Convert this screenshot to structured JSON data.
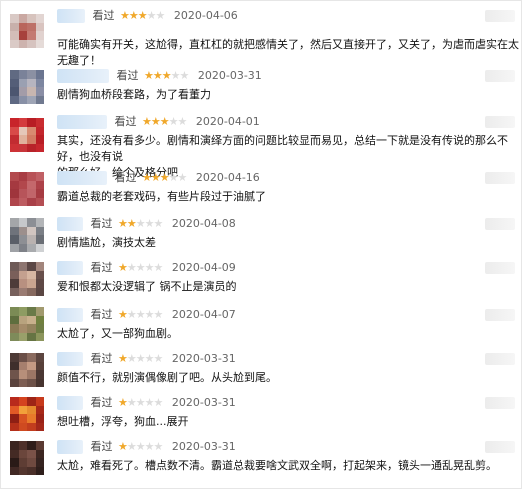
{
  "comments": [
    {
      "status": "看过",
      "rating": 3,
      "date": "2020-04-06",
      "text_lines": [
        "可能确实有开关，这尬得，直杠杠的就把感情关了，然后又直接开了，又关了，为虐而虐实在太无趣了！"
      ],
      "avatar_colors": [
        "#d9c9c5",
        "#caa8a2",
        "#d7c3bd",
        "#e2d5d2",
        "#c8b0ab",
        "#b9665c",
        "#bd7168",
        "#d9c4c0",
        "#d3bdb8",
        "#a7413c",
        "#c47a72",
        "#e1d2cf",
        "#dacac6",
        "#cdb3ae",
        "#d6c3bf",
        "#e5dbd8"
      ]
    },
    {
      "status": "看过",
      "rating": 3,
      "date": "2020-03-31",
      "text_lines": [
        "剧情狗血桥段套路，为了看董力"
      ],
      "avatar_colors": [
        "#606a82",
        "#7a8299",
        "#8b90a3",
        "#6b7590",
        "#545e78",
        "#9aa0b2",
        "#b7b5c0",
        "#7d86a0",
        "#4c5670",
        "#a39ca8",
        "#c8b6b0",
        "#8a8ea5",
        "#5f6983",
        "#8890a6",
        "#9ea4b5",
        "#70798f"
      ]
    },
    {
      "status": "看过",
      "rating": 3,
      "date": "2020-04-01",
      "text_lines": [
        "其实，还没有看多少。剧情和演绎方面的问题比较显而易见，总结一下就是没有传说的那么不好，也没有说",
        "的那么好，给个及格分吧"
      ],
      "avatar_colors": [
        "#c8242a",
        "#d43a3d",
        "#b81d24",
        "#c92c30",
        "#d84a48",
        "#e5c7b9",
        "#d88a70",
        "#c3262c",
        "#c22c31",
        "#e0b19c",
        "#d27b63",
        "#b91e25",
        "#cd3236",
        "#c8353a",
        "#b82229",
        "#c6262d"
      ]
    },
    {
      "status": "看过",
      "rating": 3,
      "date": "2020-04-16",
      "text_lines": [
        "霸道总裁的老套戏码，有些片段过于油腻了"
      ],
      "avatar_colors": [
        "#b34a4e",
        "#a83c43",
        "#b85257",
        "#c06065",
        "#a53940",
        "#b2474c",
        "#c4686c",
        "#ad4249",
        "#9f353c",
        "#b7545a",
        "#c1656a",
        "#a63b42",
        "#b0464c",
        "#bd5c61",
        "#a94048",
        "#b44e53"
      ]
    },
    {
      "status": "看过",
      "rating": 2,
      "date": "2020-04-08",
      "text_lines": [
        "剧情尴尬，演技太差"
      ],
      "avatar_colors": [
        "#a4a6a9",
        "#c6c8cb",
        "#8c8f95",
        "#b3b5b8",
        "#6f737b",
        "#9c8f8c",
        "#d1c5c0",
        "#7b7f86",
        "#5a5f68",
        "#8d8f94",
        "#b9b2b0",
        "#6a6e75",
        "#9fa2a6",
        "#7e8188",
        "#a9abae",
        "#cfd1d3"
      ]
    },
    {
      "status": "看过",
      "rating": 1,
      "date": "2020-04-09",
      "text_lines": [
        "爱和恨都太没逻辑了 锅不止是演员的"
      ],
      "avatar_colors": [
        "#6e5a57",
        "#8d7570",
        "#5b4745",
        "#a2857c",
        "#7a5f5a",
        "#c4a08f",
        "#d7b6a2",
        "#684f4b",
        "#4e3c3a",
        "#b89080",
        "#caa590",
        "#5e4845",
        "#77605c",
        "#9a7b72",
        "#86695f",
        "#5a4643"
      ]
    },
    {
      "status": "看过",
      "rating": 1,
      "date": "2020-04-07",
      "text_lines": [
        "太尬了，又一部狗血剧。"
      ],
      "avatar_colors": [
        "#7b8b55",
        "#8e9c62",
        "#6a7a48",
        "#a19a6e",
        "#5e6e3e",
        "#b8a37e",
        "#c8b08c",
        "#70803f",
        "#8a7a55",
        "#a58c6a",
        "#94835e",
        "#6f7d45",
        "#7e8b5a",
        "#99a06a",
        "#667443",
        "#8c955c"
      ]
    },
    {
      "status": "看过",
      "rating": 1,
      "date": "2020-03-31",
      "text_lines": [
        "颜值不行，就别演偶像剧了吧。从头尬到尾。"
      ],
      "avatar_colors": [
        "#4d3a36",
        "#6b4f48",
        "#8a6a5e",
        "#5c453f",
        "#3f2f2c",
        "#a67f6e",
        "#c49a84",
        "#574039",
        "#6f544b",
        "#b78f7a",
        "#9b7665",
        "#4a3733",
        "#5a433d",
        "#7d5e53",
        "#6c5148",
        "#46342f"
      ]
    },
    {
      "status": "看过",
      "rating": 1,
      "date": "2020-03-31",
      "text_lines": [
        "想吐槽，浮夸，狗血...展开"
      ],
      "avatar_colors": [
        "#b82a1c",
        "#d4431f",
        "#9e2516",
        "#c73a1c",
        "#e25a26",
        "#f2a03a",
        "#e68a2e",
        "#a82818",
        "#8e1f14",
        "#d75222",
        "#e97a2a",
        "#9a2217",
        "#b4301a",
        "#cf4a20",
        "#c23d1e",
        "#a3281a"
      ]
    },
    {
      "status": "看过",
      "rating": 1,
      "date": "2020-03-31",
      "text_lines": [
        "太尬，难看死了。槽点数不清。霸道总裁要啥文武双全啊，打起架来，镜头一通乱晃乱剪。"
      ],
      "avatar_colors": [
        "#3a2420",
        "#4e302a",
        "#2f1d1a",
        "#5a3a32",
        "#442a24",
        "#6b463c",
        "#7a5248",
        "#3c2621",
        "#2a1a17",
        "#5e3d34",
        "#6f4a40",
        "#352320",
        "#412824",
        "#53352e",
        "#4a2f29",
        "#2e1e1b"
      ]
    }
  ]
}
